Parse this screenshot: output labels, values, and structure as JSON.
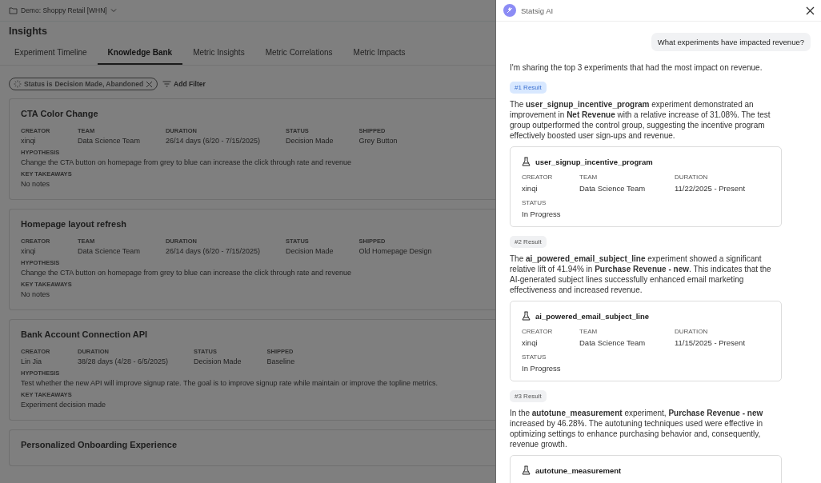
{
  "workspace": {
    "label": "Demo: Shoppy Retail [WHN]"
  },
  "page": {
    "title": "Insights"
  },
  "tabs": [
    {
      "label": "Experiment Timeline",
      "selected": false
    },
    {
      "label": "Knowledge Bank",
      "selected": true
    },
    {
      "label": "Metric Insights",
      "selected": false
    },
    {
      "label": "Metric Correlations",
      "selected": false
    },
    {
      "label": "Metric Impacts",
      "selected": false
    }
  ],
  "filters": {
    "chips": [
      {
        "field": "Status is",
        "value": "Decision Made, Abandoned"
      }
    ],
    "add_label": "Add Filter"
  },
  "cards": [
    {
      "title": "CTA Color Change",
      "fields": [
        {
          "label": "CREATOR",
          "value": "xinqi"
        },
        {
          "label": "TEAM",
          "value": "Data Science Team"
        },
        {
          "label": "DURATION",
          "value": "26/14 days (6/20 - 7/15/2025)"
        },
        {
          "label": "STATUS",
          "value": "Decision Made"
        },
        {
          "label": "SHIPPED",
          "value": "Grey Button"
        }
      ],
      "sections": [
        {
          "label": "HYPOTHESIS",
          "text": "Change the CTA button on homepage from grey to blue can increase the click through rate and revenue"
        },
        {
          "label": "KEY TAKEAWAYS",
          "text": "No notes"
        }
      ]
    },
    {
      "title": "Homepage layout refresh",
      "fields": [
        {
          "label": "CREATOR",
          "value": "xinqi"
        },
        {
          "label": "TEAM",
          "value": "Data Science Team"
        },
        {
          "label": "DURATION",
          "value": "26/14 days (6/20 - 7/15/2025)"
        },
        {
          "label": "STATUS",
          "value": "Decision Made"
        },
        {
          "label": "SHIPPED",
          "value": "Old Homepage Design"
        }
      ],
      "sections": [
        {
          "label": "HYPOTHESIS",
          "text": "Change the CTA button on homepage from grey to blue can increase the click through rate and revenue"
        },
        {
          "label": "KEY TAKEAWAYS",
          "text": "No notes"
        }
      ]
    },
    {
      "title": "Bank Account Connection API",
      "fields": [
        {
          "label": "CREATOR",
          "value": "Lin Jia"
        },
        {
          "label": "DURATION",
          "value": "38/28 days (4/28 - 6/5/2025)"
        },
        {
          "label": "STATUS",
          "value": "Decision Made"
        },
        {
          "label": "SHIPPED",
          "value": "Baseline"
        }
      ],
      "sections": [
        {
          "label": "HYPOTHESIS",
          "text": "Test whether the new API will improve signup rate. The goal is to improve signup rate while maintain or improve the topline metrics."
        },
        {
          "label": "KEY TAKEAWAYS",
          "text": "Experiment decision made"
        }
      ]
    },
    {
      "title": "Personalized Onboarding Experience"
    }
  ],
  "assistant": {
    "title": "Statsig AI",
    "user_message": "What experiments have impacted revenue?",
    "intro": "I'm sharing the top 3 experiments that had the most impact on revenue.",
    "results": [
      {
        "badge": "#1 Result",
        "selected": true,
        "text": "The **user_signup_incentive_program** experiment demonstrated an improvement in **Net Revenue** with a relative increase of 31.08%. The test group outperformed the control group, suggesting the incentive program effectively boosted user sign-ups and revenue.",
        "experiment": {
          "name": "user_signup_incentive_program",
          "fields": [
            {
              "label": "CREATOR",
              "value": "xinqi"
            },
            {
              "label": "TEAM",
              "value": "Data Science Team"
            },
            {
              "label": "DURATION",
              "value": "11/22/2025 - Present"
            },
            {
              "label": "STATUS",
              "value": "In Progress"
            }
          ]
        }
      },
      {
        "badge": "#2 Result",
        "selected": false,
        "text": "The **ai_powered_email_subject_line** experiment showed a significant relative lift of 41.94% in **Purchase Revenue - new**. This indicates that the AI-generated subject lines successfully enhanced email marketing effectiveness and increased revenue.",
        "experiment": {
          "name": "ai_powered_email_subject_line",
          "fields": [
            {
              "label": "CREATOR",
              "value": "xinqi"
            },
            {
              "label": "TEAM",
              "value": "Data Science Team"
            },
            {
              "label": "DURATION",
              "value": "11/15/2025 - Present"
            },
            {
              "label": "STATUS",
              "value": "In Progress"
            }
          ]
        }
      },
      {
        "badge": "#3 Result",
        "selected": false,
        "text": "In the **autotune_measurement** experiment, **Purchase Revenue - new** increased by 46.28%. The autotuning techniques used were effective in optimizing settings to enhance purchasing behavior and, consequently, revenue growth.",
        "experiment": {
          "name": "autotune_measurement"
        }
      }
    ]
  }
}
